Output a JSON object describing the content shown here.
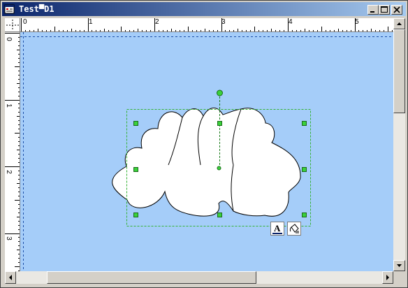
{
  "window": {
    "title": "Test▀D1",
    "minimize_label": "minimize",
    "maximize_label": "maximize",
    "close_label": "close"
  },
  "rulers": {
    "horizontal_labels": [
      "0",
      "1",
      "2",
      "3",
      "4",
      "5"
    ],
    "vertical_labels": [
      "0",
      "1",
      "2",
      "3"
    ]
  },
  "canvas": {
    "background_color": "#a5cdf9",
    "shape": "cloud",
    "shape_fill": "#ffffff",
    "selection_color": "#3ad13a"
  },
  "shape_toolbar": {
    "text_button_icon": "text-format-icon",
    "fill_button_icon": "paint-bucket-icon"
  }
}
